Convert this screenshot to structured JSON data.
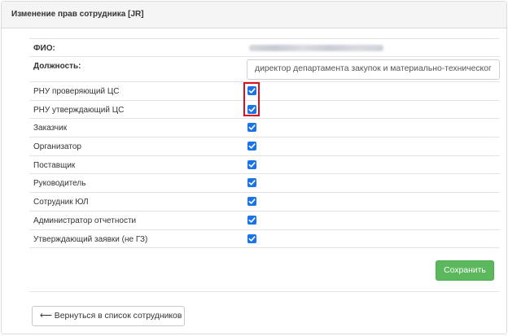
{
  "panel": {
    "title": "Изменение прав сотрудника [JR]"
  },
  "form": {
    "fio_label": "ФИО:",
    "position_label": "Должность:",
    "position_value": "директор департамента закупок и материально-техническог",
    "roles": [
      {
        "label": "РНУ проверяющий ЦС",
        "checked": true
      },
      {
        "label": "РНУ утверждающий ЦС",
        "checked": true
      },
      {
        "label": "Заказчик",
        "checked": true
      },
      {
        "label": "Организатор",
        "checked": true
      },
      {
        "label": "Поставщик",
        "checked": true
      },
      {
        "label": "Руководитель",
        "checked": true
      },
      {
        "label": "Сотрудник ЮЛ",
        "checked": true
      },
      {
        "label": "Администратор отчетности",
        "checked": true
      },
      {
        "label": "Утверждающий заявки (не ГЗ)",
        "checked": true
      }
    ]
  },
  "buttons": {
    "save_label": "Сохранить",
    "back_label": "⟵ Вернуться в список сотрудников"
  },
  "colors": {
    "checkbox": "#1a73e8",
    "highlight": "#e0101b",
    "save_button": "#5cb85c"
  }
}
